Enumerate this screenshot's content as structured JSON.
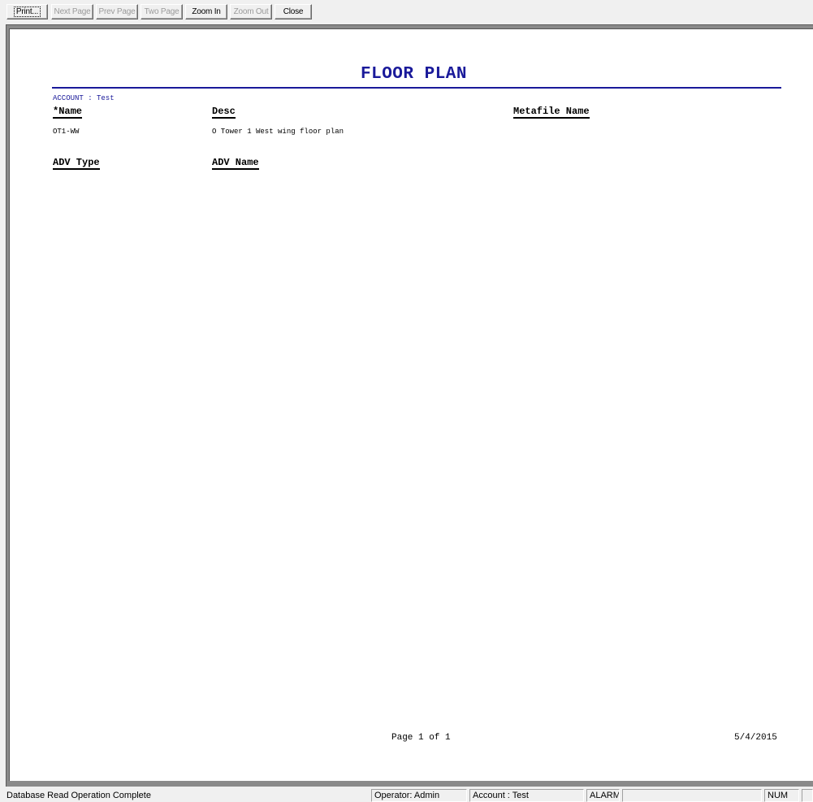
{
  "toolbar": {
    "buttons": [
      {
        "label": "Print...",
        "enabled": true
      },
      {
        "label": "Next Page",
        "enabled": false
      },
      {
        "label": "Prev Page",
        "enabled": false
      },
      {
        "label": "Two Page",
        "enabled": false
      },
      {
        "label": "Zoom In",
        "enabled": true
      },
      {
        "label": "Zoom Out",
        "enabled": false
      },
      {
        "label": "Close",
        "enabled": true
      }
    ]
  },
  "report": {
    "title": "FLOOR PLAN",
    "account_label": "ACCOUNT : Test",
    "columns": {
      "name": "*Name",
      "desc": "Desc",
      "metafile": "Metafile Name",
      "adv_type": "ADV Type",
      "adv_name": "ADV Name"
    },
    "rows": [
      {
        "name": "OT1-WW",
        "desc": "O Tower 1 West wing floor plan",
        "metafile": ""
      }
    ],
    "footer": {
      "page": "Page 1 of 1",
      "date": "5/4/2015"
    },
    "colors": {
      "title": "#1a1a9a"
    }
  },
  "statusbar": {
    "message": "Database Read Operation Complete",
    "operator": "Operator: Admin",
    "account": "Account : Test",
    "alarm": "ALARM",
    "empty": "",
    "num": "NUM"
  }
}
